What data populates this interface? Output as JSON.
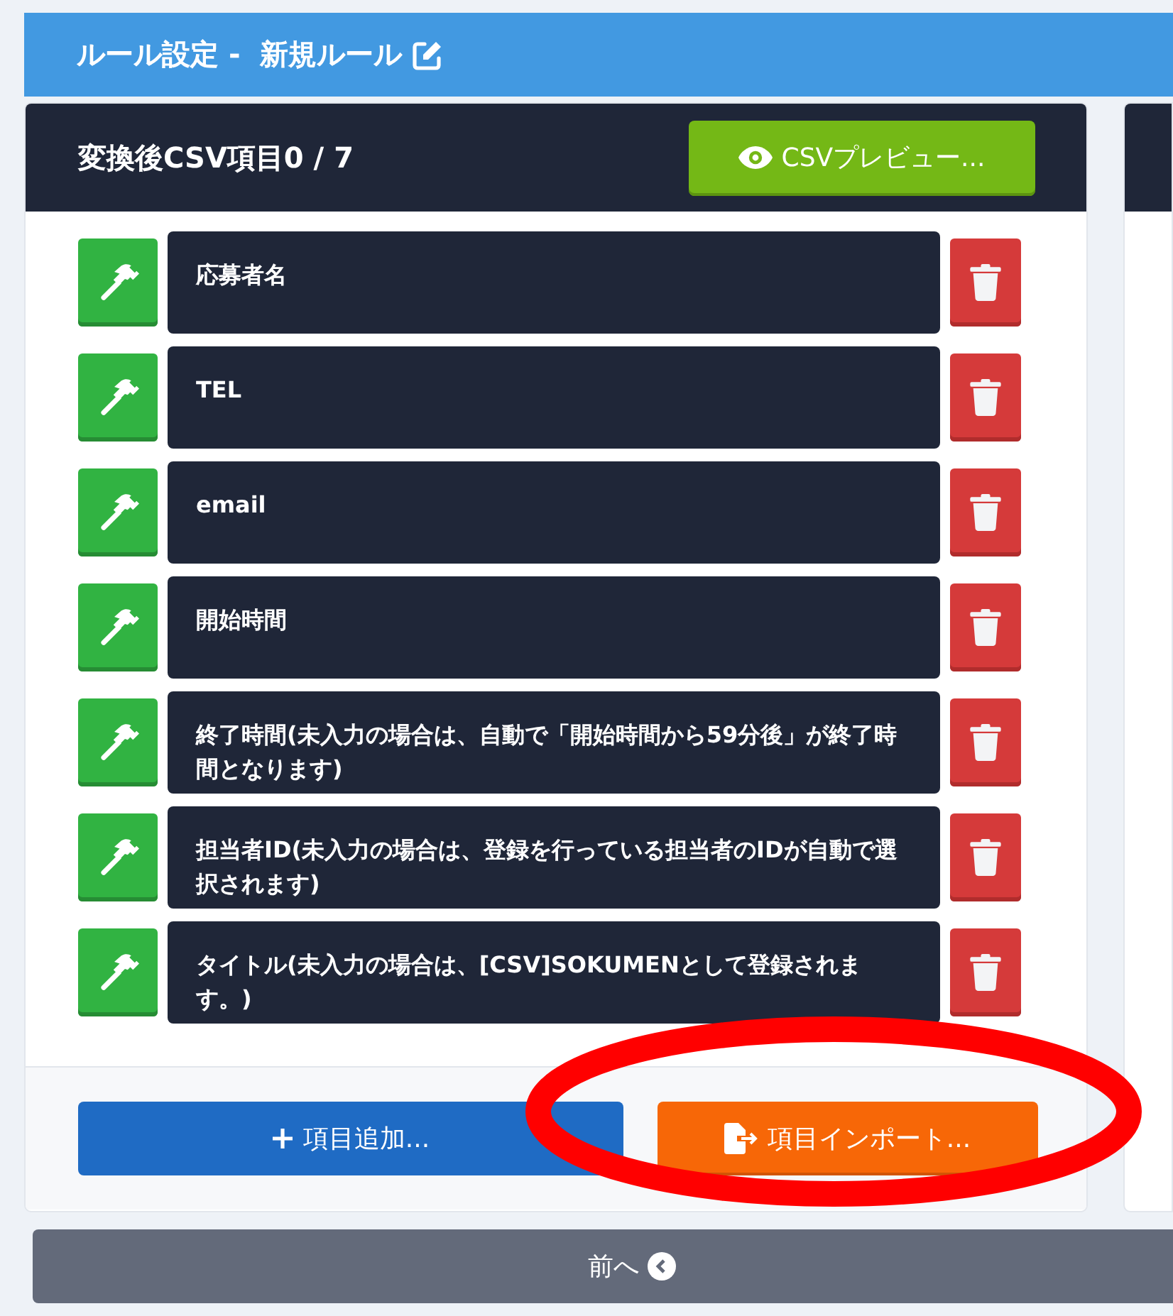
{
  "page_title": "ルール設定 -  新規ルール",
  "card": {
    "title": "変換後CSV項目0 / 7",
    "preview_button": "CSVプレビュー...",
    "items": [
      {
        "label": "応募者名"
      },
      {
        "label": "TEL"
      },
      {
        "label": "email"
      },
      {
        "label": "開始時間"
      },
      {
        "label": "終了時間(未入力の場合は、自動で「開始時間から59分後」が終了時間となります)"
      },
      {
        "label": "担当者ID(未入力の場合は、登録を行っている担当者のIDが自動で選択されます)"
      },
      {
        "label": "タイトル(未入力の場合は、[CSV]SOKUMENとして登録されます。)"
      }
    ],
    "add_button": "項目追加...",
    "import_button": "項目インポート..."
  },
  "back_button": "前へ"
}
